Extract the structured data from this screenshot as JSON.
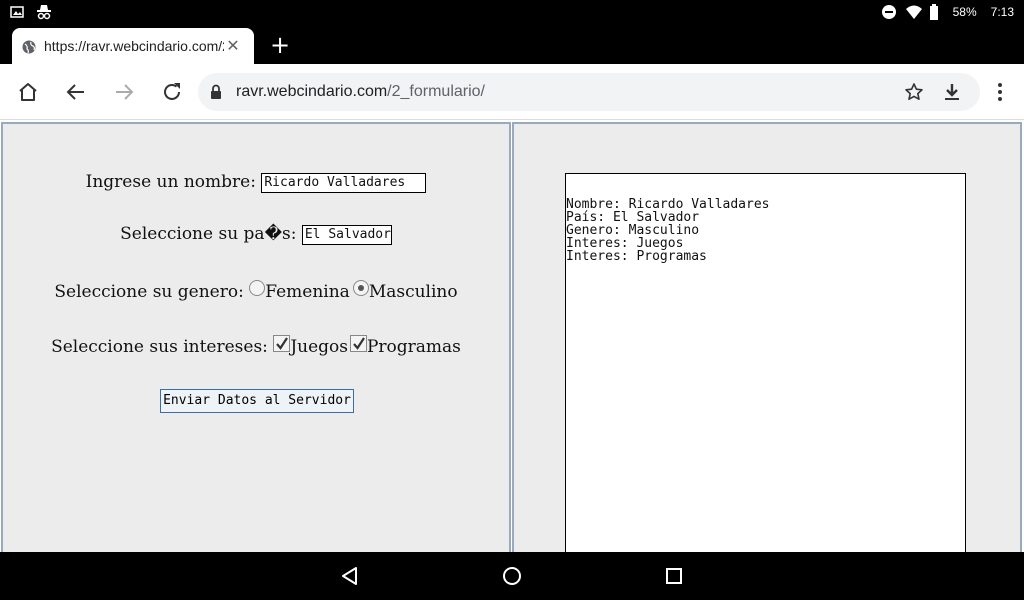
{
  "status_bar": {
    "left_icons": [
      "image-icon",
      "incognito-icon"
    ],
    "battery": "58%",
    "time": "7:13",
    "right_icons": [
      "do-not-disturb-icon",
      "wifi-icon",
      "battery-icon"
    ]
  },
  "browser": {
    "tab_title": "https://ravr.webcindario.com/2_formulario/",
    "url_domain": "ravr.webcindario.com",
    "url_path": "/2_formulario/"
  },
  "form": {
    "name_label": "Ingrese un nombre:",
    "name_value": "Ricardo Valladares",
    "country_label": "Seleccione su pa�s:",
    "country_value": "El Salvador",
    "gender_label": "Seleccione su genero:",
    "gender_options": [
      "Femenina",
      "Masculino"
    ],
    "gender_selected": "Masculino",
    "interests_label": "Seleccione sus intereses:",
    "interests": [
      {
        "label": "Juegos",
        "checked": true
      },
      {
        "label": "Programas",
        "checked": true
      }
    ],
    "submit_label": "Enviar Datos al Servidor"
  },
  "output": {
    "lines": [
      "Nombre: Ricardo Valladares",
      "País: El Salvador",
      "Genero: Masculino",
      "Interes: Juegos",
      "Interes: Programas"
    ]
  },
  "colors": {
    "frame_background": "#ececec",
    "frame_border": "#9aaabe",
    "button_border": "#3a6ea5"
  }
}
